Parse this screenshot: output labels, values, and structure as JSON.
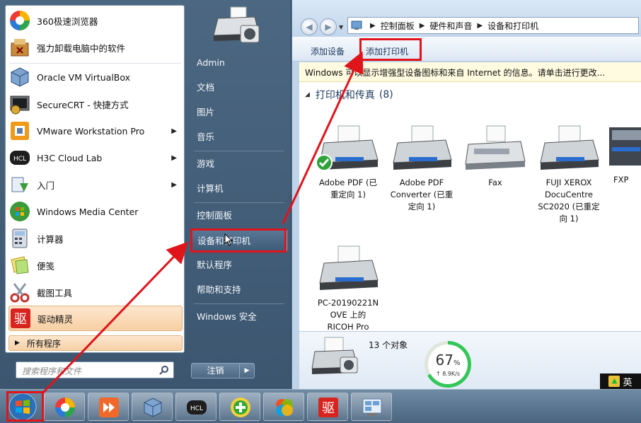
{
  "explorer": {
    "breadcrumb": [
      "控制面板",
      "硬件和声音",
      "设备和打印机"
    ],
    "toolbar": {
      "add_device": "添加设备",
      "add_printer": "添加打印机"
    },
    "infobar": "Windows 可以显示增强型设备图标和来自 Internet 的信息。请单击进行更改...",
    "group": {
      "title": "打印机和传真",
      "count": "(8)"
    },
    "devices": [
      {
        "label": "Adobe PDF (已重定向 1)",
        "line1": "Adobe PDF (已",
        "line2": "重定向 1)",
        "line3": "",
        "line4": ""
      },
      {
        "label": "Adobe PDF Converter (已重定向 1)",
        "line1": "Adobe PDF",
        "line2": "Converter (已重",
        "line3": "定向 1)",
        "line4": ""
      },
      {
        "label": "Fax",
        "line1": "Fax",
        "line2": "",
        "line3": "",
        "line4": ""
      },
      {
        "label": "FUJI XEROX DocuCentre SC2020 (已重定向 1)",
        "line1": "FUJI XEROX",
        "line2": "DocuCentre",
        "line3": "SC2020 (已重定",
        "line4": "向 1)"
      },
      {
        "label": "FXP",
        "line1": "FXP",
        "line2": "",
        "line3": "",
        "line4": ""
      },
      {
        "label": "PC-20190221NOVE 上的 RICOH Pro",
        "line1": "PC-20190221N",
        "line2": "OVE 上的",
        "line3": "RICOH Pro",
        "line4": ""
      }
    ],
    "details": {
      "object_count": "13 个对象"
    }
  },
  "net_gauge": {
    "percent": "67",
    "percent_sign": "%",
    "speed": "↑ 8.9K/s",
    "fraction": 0.67
  },
  "ime": {
    "label": "英"
  },
  "start_menu": {
    "programs": [
      {
        "label": "360极速浏览器",
        "icon": "360-browser-icon",
        "has_arrow": false
      },
      {
        "label": "强力卸载电脑中的软件",
        "icon": "uninstall-icon",
        "has_arrow": false
      },
      {
        "label": "Oracle VM VirtualBox",
        "icon": "virtualbox-icon",
        "has_arrow": false
      },
      {
        "label": "SecureCRT - 快捷方式",
        "icon": "securecrt-icon",
        "has_arrow": false
      },
      {
        "label": "VMware Workstation Pro",
        "icon": "vmware-icon",
        "has_arrow": true
      },
      {
        "label": "H3C Cloud Lab",
        "icon": "h3c-icon",
        "has_arrow": true
      },
      {
        "label": "入门",
        "icon": "getting-started-icon",
        "has_arrow": true
      },
      {
        "label": "Windows Media Center",
        "icon": "media-center-icon",
        "has_arrow": false
      },
      {
        "label": "计算器",
        "icon": "calculator-icon",
        "has_arrow": false
      },
      {
        "label": "便笺",
        "icon": "sticky-notes-icon",
        "has_arrow": false
      },
      {
        "label": "截图工具",
        "icon": "snipping-tool-icon",
        "has_arrow": false
      },
      {
        "label": "驱动精灵",
        "icon": "driver-genius-icon",
        "has_arrow": false
      }
    ],
    "all_programs": "所有程序",
    "search_placeholder": "搜索程序和文件",
    "right_items": [
      "Admin",
      "文档",
      "图片",
      "音乐",
      "游戏",
      "计算机",
      "控制面板",
      "设备和打印机",
      "默认程序",
      "帮助和支持",
      "Windows 安全"
    ],
    "shutdown_label": "注销"
  },
  "taskbar": {
    "items": [
      "360-browser-icon",
      "media-player-icon",
      "virtualbox-icon",
      "h3c-icon",
      "360-safe-icon",
      "windows-photo-icon",
      "driver-genius-icon",
      "control-panel-icon"
    ]
  },
  "colors": {
    "annotation_red": "#e0141b",
    "start_menu_bg": "#4c6781",
    "highlight_orange": "#f7cfa3"
  }
}
